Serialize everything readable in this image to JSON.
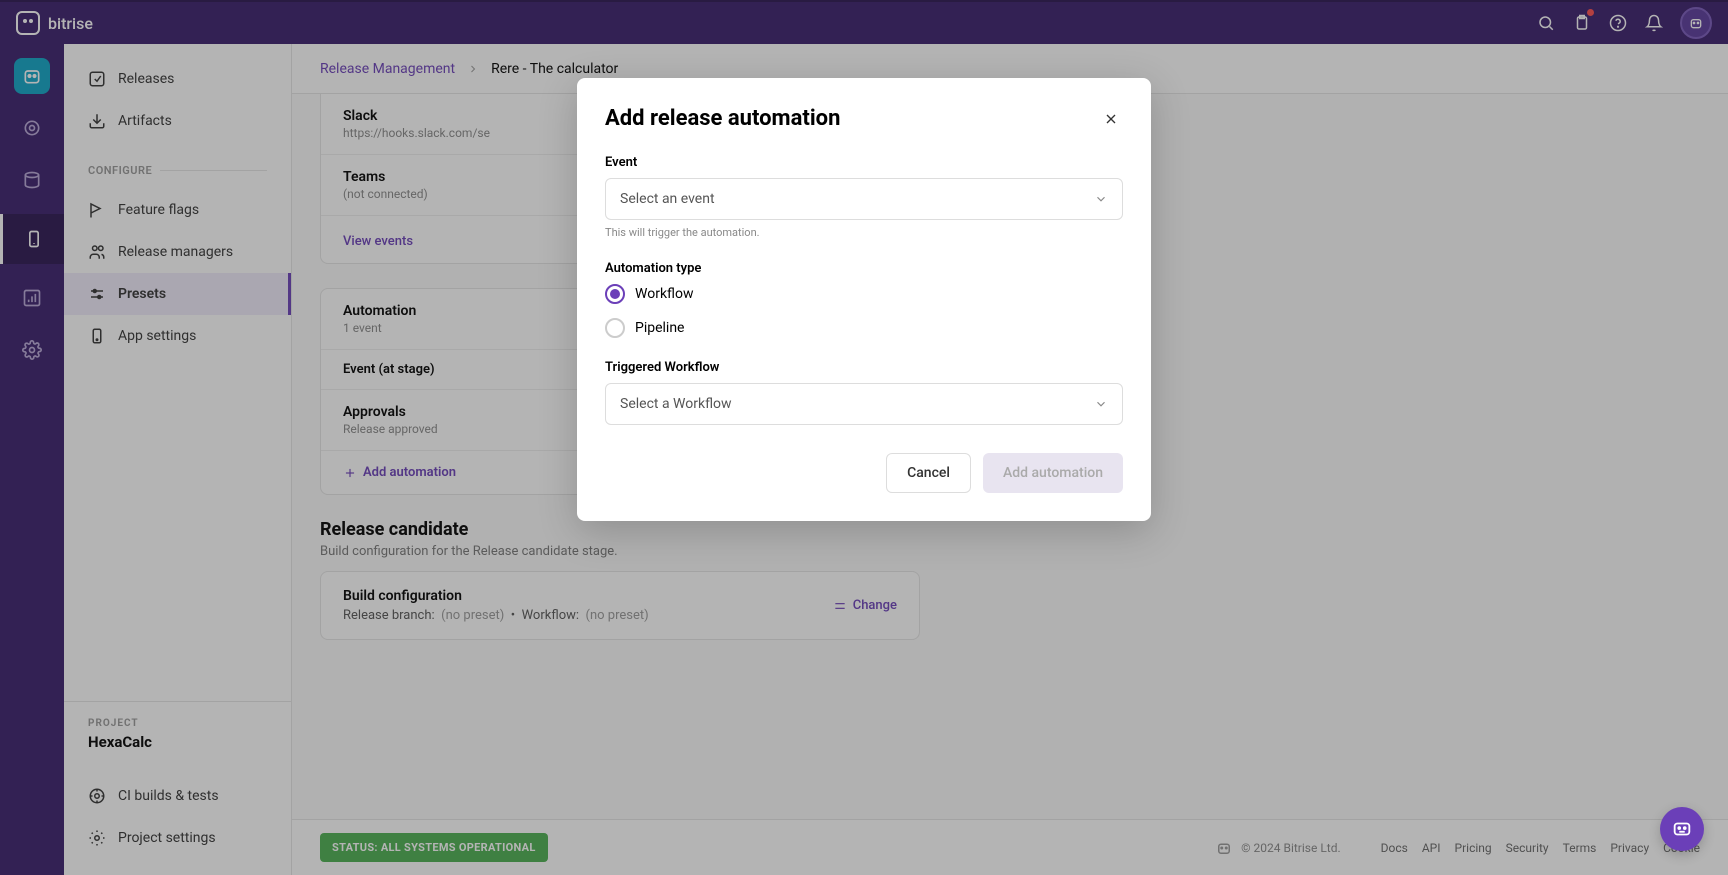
{
  "brand": "bitrise",
  "breadcrumb": {
    "section": "Release Management",
    "app": "Rere - The calculator"
  },
  "sidebar": {
    "main": [
      {
        "label": "Releases"
      },
      {
        "label": "Artifacts"
      }
    ],
    "configure_label": "CONFIGURE",
    "configure": [
      {
        "label": "Feature flags"
      },
      {
        "label": "Release managers"
      },
      {
        "label": "Presets"
      },
      {
        "label": "App settings"
      }
    ],
    "project_label": "PROJECT",
    "project_name": "HexaCalc",
    "project_links": [
      {
        "label": "CI builds & tests"
      },
      {
        "label": "Project settings"
      }
    ]
  },
  "integrations": {
    "slack": {
      "title": "Slack",
      "sub": "https://hooks.slack.com/se"
    },
    "teams": {
      "title": "Teams",
      "sub": "(not connected)"
    },
    "view_events": "View events"
  },
  "automation": {
    "title": "Automation",
    "count": "1 event",
    "col_head": "Event (at stage)",
    "row": {
      "title": "Approvals",
      "sub": "Release approved"
    },
    "add": "Add automation"
  },
  "release_candidate": {
    "title": "Release candidate",
    "sub": "Build configuration for the Release candidate stage.",
    "build_title": "Build configuration",
    "branch_label": "Release branch:",
    "branch_value": "(no preset)",
    "workflow_label": "Workflow:",
    "workflow_value": "(no preset)",
    "sep": "•",
    "change": "Change"
  },
  "footer": {
    "status": "STATUS: ALL SYSTEMS OPERATIONAL",
    "copyright": "© 2024 Bitrise Ltd.",
    "links": [
      "Docs",
      "API",
      "Pricing",
      "Security",
      "Terms",
      "Privacy",
      "Cookie"
    ]
  },
  "modal": {
    "title": "Add release automation",
    "event_label": "Event",
    "event_placeholder": "Select an event",
    "event_helper": "This will trigger the automation.",
    "type_label": "Automation type",
    "type_workflow": "Workflow",
    "type_pipeline": "Pipeline",
    "triggered_label": "Triggered Workflow",
    "triggered_placeholder": "Select a Workflow",
    "cancel": "Cancel",
    "submit": "Add automation"
  }
}
